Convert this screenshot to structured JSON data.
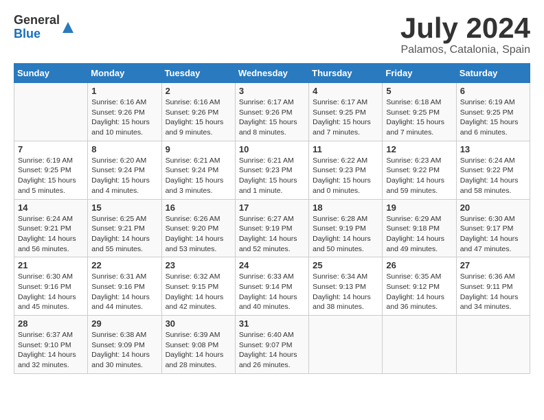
{
  "logo": {
    "general": "General",
    "blue": "Blue"
  },
  "title": "July 2024",
  "location": "Palamos, Catalonia, Spain",
  "days_of_week": [
    "Sunday",
    "Monday",
    "Tuesday",
    "Wednesday",
    "Thursday",
    "Friday",
    "Saturday"
  ],
  "weeks": [
    [
      {
        "day": "",
        "info": ""
      },
      {
        "day": "1",
        "info": "Sunrise: 6:16 AM\nSunset: 9:26 PM\nDaylight: 15 hours\nand 10 minutes."
      },
      {
        "day": "2",
        "info": "Sunrise: 6:16 AM\nSunset: 9:26 PM\nDaylight: 15 hours\nand 9 minutes."
      },
      {
        "day": "3",
        "info": "Sunrise: 6:17 AM\nSunset: 9:26 PM\nDaylight: 15 hours\nand 8 minutes."
      },
      {
        "day": "4",
        "info": "Sunrise: 6:17 AM\nSunset: 9:25 PM\nDaylight: 15 hours\nand 7 minutes."
      },
      {
        "day": "5",
        "info": "Sunrise: 6:18 AM\nSunset: 9:25 PM\nDaylight: 15 hours\nand 7 minutes."
      },
      {
        "day": "6",
        "info": "Sunrise: 6:19 AM\nSunset: 9:25 PM\nDaylight: 15 hours\nand 6 minutes."
      }
    ],
    [
      {
        "day": "7",
        "info": "Sunrise: 6:19 AM\nSunset: 9:25 PM\nDaylight: 15 hours\nand 5 minutes."
      },
      {
        "day": "8",
        "info": "Sunrise: 6:20 AM\nSunset: 9:24 PM\nDaylight: 15 hours\nand 4 minutes."
      },
      {
        "day": "9",
        "info": "Sunrise: 6:21 AM\nSunset: 9:24 PM\nDaylight: 15 hours\nand 3 minutes."
      },
      {
        "day": "10",
        "info": "Sunrise: 6:21 AM\nSunset: 9:23 PM\nDaylight: 15 hours\nand 1 minute."
      },
      {
        "day": "11",
        "info": "Sunrise: 6:22 AM\nSunset: 9:23 PM\nDaylight: 15 hours\nand 0 minutes."
      },
      {
        "day": "12",
        "info": "Sunrise: 6:23 AM\nSunset: 9:22 PM\nDaylight: 14 hours\nand 59 minutes."
      },
      {
        "day": "13",
        "info": "Sunrise: 6:24 AM\nSunset: 9:22 PM\nDaylight: 14 hours\nand 58 minutes."
      }
    ],
    [
      {
        "day": "14",
        "info": "Sunrise: 6:24 AM\nSunset: 9:21 PM\nDaylight: 14 hours\nand 56 minutes."
      },
      {
        "day": "15",
        "info": "Sunrise: 6:25 AM\nSunset: 9:21 PM\nDaylight: 14 hours\nand 55 minutes."
      },
      {
        "day": "16",
        "info": "Sunrise: 6:26 AM\nSunset: 9:20 PM\nDaylight: 14 hours\nand 53 minutes."
      },
      {
        "day": "17",
        "info": "Sunrise: 6:27 AM\nSunset: 9:19 PM\nDaylight: 14 hours\nand 52 minutes."
      },
      {
        "day": "18",
        "info": "Sunrise: 6:28 AM\nSunset: 9:19 PM\nDaylight: 14 hours\nand 50 minutes."
      },
      {
        "day": "19",
        "info": "Sunrise: 6:29 AM\nSunset: 9:18 PM\nDaylight: 14 hours\nand 49 minutes."
      },
      {
        "day": "20",
        "info": "Sunrise: 6:30 AM\nSunset: 9:17 PM\nDaylight: 14 hours\nand 47 minutes."
      }
    ],
    [
      {
        "day": "21",
        "info": "Sunrise: 6:30 AM\nSunset: 9:16 PM\nDaylight: 14 hours\nand 45 minutes."
      },
      {
        "day": "22",
        "info": "Sunrise: 6:31 AM\nSunset: 9:16 PM\nDaylight: 14 hours\nand 44 minutes."
      },
      {
        "day": "23",
        "info": "Sunrise: 6:32 AM\nSunset: 9:15 PM\nDaylight: 14 hours\nand 42 minutes."
      },
      {
        "day": "24",
        "info": "Sunrise: 6:33 AM\nSunset: 9:14 PM\nDaylight: 14 hours\nand 40 minutes."
      },
      {
        "day": "25",
        "info": "Sunrise: 6:34 AM\nSunset: 9:13 PM\nDaylight: 14 hours\nand 38 minutes."
      },
      {
        "day": "26",
        "info": "Sunrise: 6:35 AM\nSunset: 9:12 PM\nDaylight: 14 hours\nand 36 minutes."
      },
      {
        "day": "27",
        "info": "Sunrise: 6:36 AM\nSunset: 9:11 PM\nDaylight: 14 hours\nand 34 minutes."
      }
    ],
    [
      {
        "day": "28",
        "info": "Sunrise: 6:37 AM\nSunset: 9:10 PM\nDaylight: 14 hours\nand 32 minutes."
      },
      {
        "day": "29",
        "info": "Sunrise: 6:38 AM\nSunset: 9:09 PM\nDaylight: 14 hours\nand 30 minutes."
      },
      {
        "day": "30",
        "info": "Sunrise: 6:39 AM\nSunset: 9:08 PM\nDaylight: 14 hours\nand 28 minutes."
      },
      {
        "day": "31",
        "info": "Sunrise: 6:40 AM\nSunset: 9:07 PM\nDaylight: 14 hours\nand 26 minutes."
      },
      {
        "day": "",
        "info": ""
      },
      {
        "day": "",
        "info": ""
      },
      {
        "day": "",
        "info": ""
      }
    ]
  ]
}
